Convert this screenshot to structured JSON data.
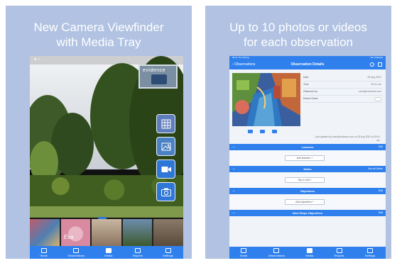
{
  "left_panel": {
    "headline": [
      "New Camera Viewfinder",
      "with Media Tray"
    ],
    "evidence_badge": "evidence",
    "camera_buttons": [
      "grid-icon",
      "gallery-icon",
      "video-icon",
      "camera-icon"
    ],
    "tray_thumbnails": [
      "thumb-1",
      "thumb-2",
      "thumb-3",
      "thumb-4",
      "thumb-5"
    ],
    "tray_label": "Eva",
    "tabs": [
      {
        "label": "Home",
        "icon": "home-icon"
      },
      {
        "label": "Observations",
        "icon": "observations-icon"
      },
      {
        "label": "Media",
        "icon": "media-icon",
        "active": true
      },
      {
        "label": "Reports",
        "icon": "reports-icon"
      },
      {
        "label": "Settings",
        "icon": "settings-icon"
      }
    ]
  },
  "right_panel": {
    "headline": [
      "Up to 10 photos or videos",
      "for each observation"
    ],
    "status_left": "09:41  Thu 25 Aug",
    "status_right": "Not Charging",
    "nav_back": "Observations",
    "nav_title": "Observation Details",
    "fields": [
      {
        "label": "Date",
        "value": "25 Aug 2022"
      },
      {
        "label": "Time",
        "value": "09:41 am"
      },
      {
        "label": "Observed by",
        "value": "user@evidence.com"
      },
      {
        "label": "Parent Share",
        "value": ""
      }
    ],
    "saved_note": "Last updated by user@evidence.com on 25 Aug 2022 at 09:41 am",
    "sections": [
      {
        "title": "Learners",
        "action": "Edit",
        "button": "Add learners +"
      },
      {
        "title": "Notes",
        "action": "See all Notes",
        "button": "Tap to edit +"
      },
      {
        "title": "Objectives",
        "action": "Edit",
        "button": "Add objectives +"
      },
      {
        "title": "Next Steps Objectives",
        "action": "Edit",
        "button": ""
      }
    ],
    "tabs": [
      "Home",
      "Observations",
      "Media",
      "Reports",
      "Settings"
    ]
  },
  "colors": {
    "panel_bg": "#b1c2e2",
    "accent_blue": "#2f80ed"
  }
}
